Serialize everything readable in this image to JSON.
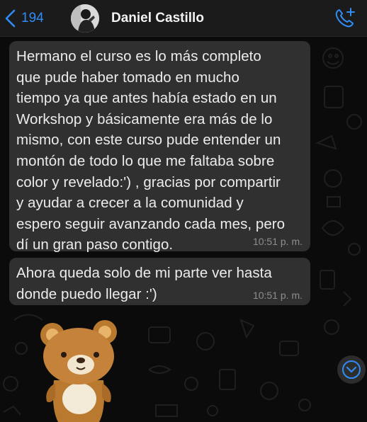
{
  "header": {
    "back_count": "194",
    "contact_name": "Daniel Castillo",
    "back_icon": "chevron-left-icon",
    "call_icon": "add-call-icon"
  },
  "messages": [
    {
      "text": "Hermano el curso es lo más completo\nque pude haber tomado en mucho\ntiempo ya que antes había estado en un\nWorkshop y básicamente era más de lo\nmismo, con este curso pude entender un\nmontón de todo lo que me faltaba sobre\ncolor y revelado:') , gracias por compartir\ny ayudar a crecer a la comunidad y\nespero seguir avanzando cada mes, pero\ndí un gran paso contigo.",
      "time": "10:51 p. m."
    },
    {
      "text": "Ahora queda solo de mi parte ver hasta\ndonde puedo llegar :')",
      "time": "10:51 p. m."
    }
  ],
  "sticker": {
    "icon": "teddy-bear-sticker"
  },
  "scroll_button": {
    "icon": "chevron-down-icon"
  },
  "colors": {
    "accent": "#2f8df5",
    "bubble": "#303030",
    "background": "#0b0b0b",
    "header": "#1b1b1b",
    "timestamp": "#8e8e8e"
  }
}
